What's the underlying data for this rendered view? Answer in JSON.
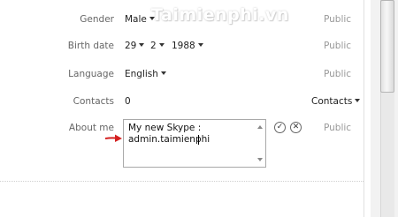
{
  "watermark": "Taimienphi.vn",
  "visibility_label": "Public",
  "rows": {
    "gender": {
      "label": "Gender",
      "value": "Male",
      "visibility": "Public"
    },
    "birth_date": {
      "label": "Birth date",
      "day": "29",
      "month": "2",
      "year": "1988",
      "visibility": "Public"
    },
    "language": {
      "label": "Language",
      "value": "English",
      "visibility": "Public"
    },
    "contacts": {
      "label": "Contacts",
      "value": "0",
      "dropdown": "Contacts"
    },
    "about_me": {
      "label": "About me",
      "text": "My new Skype :\nadmin.taimienphi",
      "visibility": "Public"
    }
  },
  "icons": {
    "confirm": "checkmark-icon",
    "cancel": "close-icon",
    "pointer": "red-arrow-icon"
  }
}
